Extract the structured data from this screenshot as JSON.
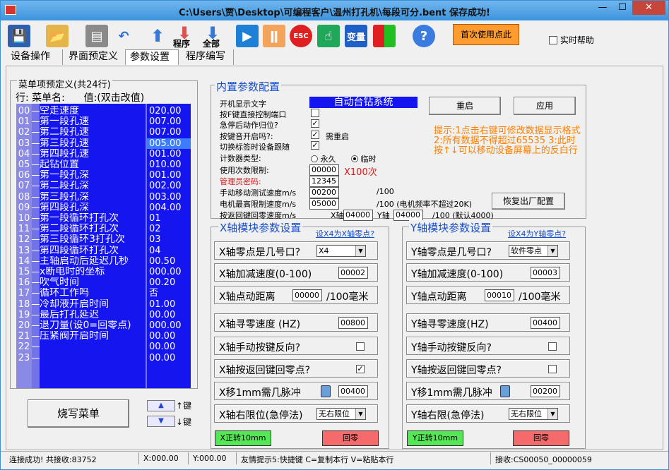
{
  "window": {
    "title": "C:\\Users\\贾\\Desktop\\可编程客户\\温州打孔机\\每段可分.bent  保存成功!",
    "min": "—",
    "max": "☐",
    "close": "✕"
  },
  "toolbar": {
    "program_label": "程序",
    "all_label": "全部",
    "first_use": "首次使用点此",
    "realtime_help": "实时帮助"
  },
  "tabs": [
    "设备操作",
    "界面预定义",
    "参数设置",
    "程序编写"
  ],
  "menu": {
    "title": "菜单项预定义(共24行)",
    "header": "行: 菜单名:      值:(双击改值)",
    "rows": [
      {
        "idx": "00",
        "name": "空走速度",
        "val": "020.00"
      },
      {
        "idx": "01",
        "name": "第一段孔速",
        "val": "007.00"
      },
      {
        "idx": "02",
        "name": "第二段孔速",
        "val": "007.00"
      },
      {
        "idx": "03",
        "name": "第三段孔速",
        "val": "005.00"
      },
      {
        "idx": "04",
        "name": "第四段孔速",
        "val": "001.00"
      },
      {
        "idx": "05",
        "name": "起钻位置",
        "val": "010.00"
      },
      {
        "idx": "06",
        "name": "第一段孔深",
        "val": "001.00"
      },
      {
        "idx": "07",
        "name": "第二段孔深",
        "val": "002.00"
      },
      {
        "idx": "08",
        "name": "第三段孔深",
        "val": "003.00"
      },
      {
        "idx": "09",
        "name": "第四段孔深",
        "val": "004.00"
      },
      {
        "idx": "10",
        "name": "第一段循环打孔次",
        "val": "01"
      },
      {
        "idx": "11",
        "name": "第二段循环打孔次",
        "val": "02"
      },
      {
        "idx": "12",
        "name": "第三段循环3打孔次",
        "val": "03"
      },
      {
        "idx": "13",
        "name": "第四段循环打孔次",
        "val": "04"
      },
      {
        "idx": "14",
        "name": "主轴启动后延迟几秒",
        "val": "00.50"
      },
      {
        "idx": "15",
        "name": "x断电时的坐标",
        "val": "000.00"
      },
      {
        "idx": "16",
        "name": "吹气时间",
        "val": "00.20"
      },
      {
        "idx": "17",
        "name": "循环工作吗",
        "val": "否"
      },
      {
        "idx": "18",
        "name": "冷却液开启时间",
        "val": "01.00"
      },
      {
        "idx": "19",
        "name": "最后打孔延迟",
        "val": "00.00"
      },
      {
        "idx": "20",
        "name": "退刀量(设0=回零点)",
        "val": "000.00"
      },
      {
        "idx": "21",
        "name": "压紧阀开启时间",
        "val": "00.00"
      },
      {
        "idx": "22",
        "name": "",
        "val": "00.00"
      },
      {
        "idx": "23",
        "name": "",
        "val": "00.00"
      }
    ],
    "burn_button": "烧写菜单",
    "key_label": "键"
  },
  "builtin": {
    "title": "内置参数配置",
    "boot_text_label": "开机显示文字",
    "boot_text": "自动台钻系统",
    "press_f_label": "按F键直接控制端口",
    "estop_label": "急停后动作归位?",
    "key_sound_label": "按键音开启吗?:",
    "need_restart": "需重启",
    "switch_label": "切换标签时设备跟随",
    "counter_label": "计数器类型:",
    "counter_permanent": "永久",
    "counter_temp": "临时",
    "usage_limit_label": "使用次数限制:",
    "usage_limit": "00000",
    "x100": "X100次",
    "admin_pwd_label": "管理员密码:",
    "admin_pwd": "12345",
    "manual_speed_label": "手动移动测试速度m/s",
    "manual_speed": "00200",
    "per100a": "/100",
    "motor_max_label": "电机最高限制速度m/s",
    "motor_max": "05000",
    "per100b": "/100 (电机频率不超过20K)",
    "return_speed_label": "按返回键回零速度m/s",
    "x_axis": "X轴",
    "x_return": "04000",
    "y_axis": "Y轴",
    "y_return": "04000",
    "per100c": "/100 (默认4000)",
    "restart_btn": "重启",
    "apply_btn": "应用",
    "factory_btn": "恢复出厂配置",
    "hint": "提示:1点击右键可修改数据显示格式 2:所有数据不得超过65535 3:此时按↑↓可以移动设备屏幕上的反白行"
  },
  "x_axis": {
    "title": "X轴模块参数设置",
    "link": "设X4为X轴零点?",
    "zero_port_label": "X轴零点是几号口?",
    "zero_port": "X4",
    "accel_label": "X轴加减速度(0-100)",
    "accel": "00002",
    "jog_label": "X轴点动距离",
    "jog": "00000",
    "jog_unit": "/100毫米",
    "home_speed_label": "X轴寻零速度 (HZ)",
    "home_speed": "00800",
    "manual_rev_label": "X轴手动按键反向?",
    "return_home_label": "X轴按返回键回零点?",
    "pulse_label": "X移1mm需几脉冲",
    "pulse": "00400",
    "limit_label": "X轴右限位(急停法)",
    "limit": "无右限位",
    "fwd_btn": "X正转10mm",
    "home_btn": "回零"
  },
  "y_axis": {
    "title": "Y轴模块参数设置",
    "link": "设X4为Y轴零点?",
    "zero_port_label": "Y轴零点是几号口?",
    "zero_port": "软件零点",
    "accel_label": "Y轴加减速度(0-100)",
    "accel": "00003",
    "jog_label": "Y轴点动距离",
    "jog": "00010",
    "jog_unit": "/100毫米",
    "home_speed_label": "Y轴寻零速度(HZ)",
    "home_speed": "00400",
    "manual_rev_label": "Y轴手动按键反向?",
    "return_home_label": "Y轴按返回键回零点?",
    "pulse_label": "Y移1mm需几脉冲",
    "pulse": "00200",
    "limit_label": "Y轴右限(急停法)",
    "limit": "无右限位",
    "fwd_btn": "Y正转10mm",
    "home_btn": "回零"
  },
  "status": {
    "conn": "连接成功! 共接收:83752",
    "x": "X:000.00",
    "y": "Y:000.00",
    "tip": "友情提示5:快捷键 C=复制本行 V=粘贴本行",
    "recv": "接收:CS00050_00000059"
  }
}
